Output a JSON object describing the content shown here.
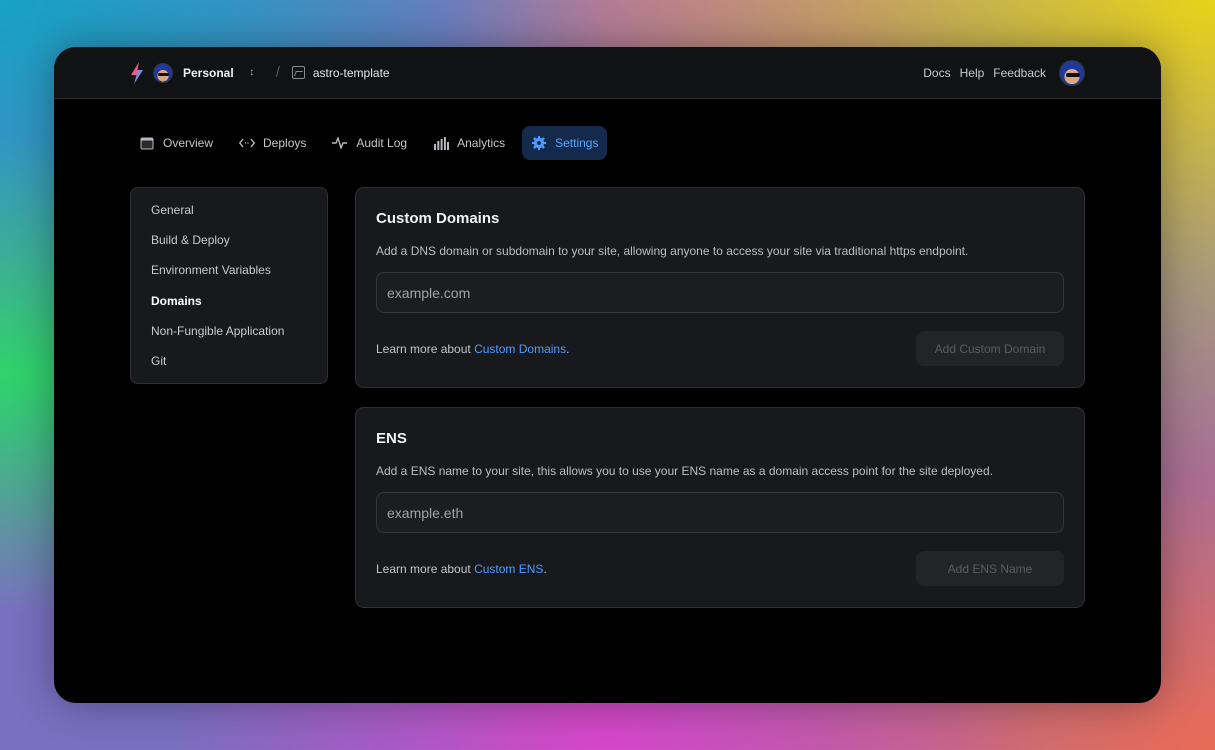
{
  "header": {
    "workspace": "Personal",
    "site_name": "astro-template",
    "links": {
      "docs": "Docs",
      "help": "Help",
      "feedback": "Feedback"
    }
  },
  "tabs": [
    {
      "label": "Overview",
      "icon": "window-icon"
    },
    {
      "label": "Deploys",
      "icon": "code-arrows-icon"
    },
    {
      "label": "Audit Log",
      "icon": "activity-icon"
    },
    {
      "label": "Analytics",
      "icon": "bar-chart-icon"
    },
    {
      "label": "Settings",
      "icon": "gear-icon",
      "active": true
    }
  ],
  "sidebar": {
    "items": [
      {
        "label": "General"
      },
      {
        "label": "Build & Deploy"
      },
      {
        "label": "Environment Variables"
      },
      {
        "label": "Domains",
        "active": true
      },
      {
        "label": "Non-Fungible Application"
      },
      {
        "label": "Git"
      }
    ]
  },
  "custom_domains": {
    "title": "Custom Domains",
    "description": "Add a DNS domain or subdomain to your site, allowing anyone to access your site via traditional https endpoint.",
    "input_placeholder": "example.com",
    "learn_prefix": "Learn more about",
    "learn_link": "Custom Domains",
    "learn_suffix": ".",
    "button_label": "Add Custom Domain"
  },
  "ens": {
    "title": "ENS",
    "description": "Add a ENS name to your site, this allows you to use your ENS name as a domain access point for the site deployed.",
    "input_placeholder": "example.eth",
    "learn_prefix": "Learn more about",
    "learn_link": "Custom ENS",
    "learn_suffix": ".",
    "button_label": "Add ENS Name"
  },
  "colors": {
    "accent": "#4e9cff",
    "active_tab_bg": "#142a4d",
    "card_bg": "#18191c",
    "page_bg": "#000000"
  }
}
